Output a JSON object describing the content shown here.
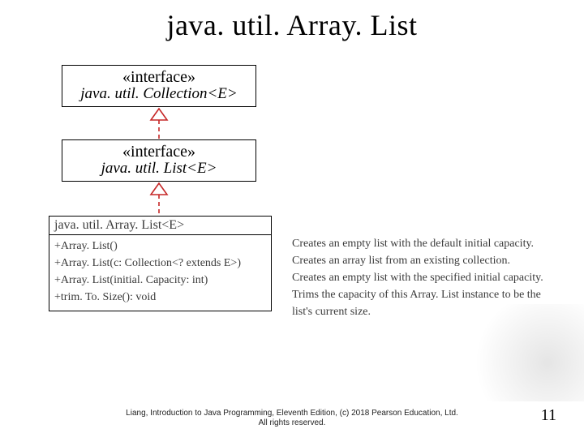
{
  "title": "java. util. Array. List",
  "interfaces": {
    "collection": {
      "stereotype": "«interface»",
      "name": "java. util. Collection<E>"
    },
    "list": {
      "stereotype": "«interface»",
      "name": "java. util. List<E>"
    }
  },
  "class": {
    "name": "java. util. Array. List<E>"
  },
  "methods": [
    {
      "sig": "+Array. List()",
      "desc": "Creates an empty list with the default initial capacity."
    },
    {
      "sig": "+Array. List(c: Collection<? extends E>)",
      "desc": "Creates an array list from an existing collection."
    },
    {
      "sig": "+Array. List(initial. Capacity: int)",
      "desc": "Creates an empty list with the specified initial capacity."
    },
    {
      "sig": "+trim. To. Size(): void",
      "desc": "Trims the capacity of this Array. List instance to be the list's current size."
    }
  ],
  "footer": {
    "line1": "Liang, Introduction to Java Programming, Eleventh Edition, (c) 2018 Pearson Education, Ltd.",
    "line2": "All rights reserved."
  },
  "page": "11"
}
